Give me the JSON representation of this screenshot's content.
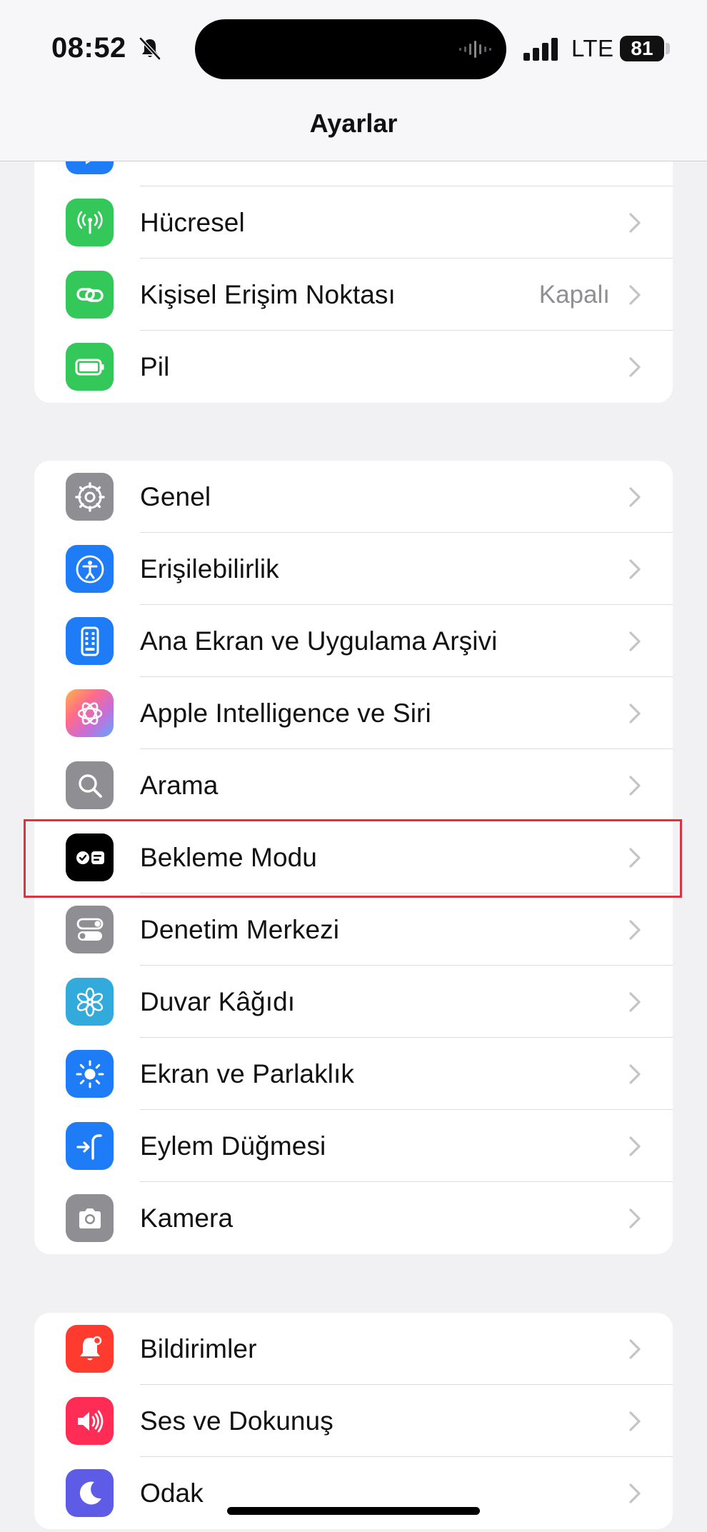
{
  "status_bar": {
    "time": "08:52",
    "network": "LTE",
    "battery": "81"
  },
  "header": {
    "title": "Ayarlar"
  },
  "groups": [
    {
      "items": [
        {
          "label": "",
          "icon": "partial-blue-icon",
          "color": "#1f7cf7"
        },
        {
          "label": "Hücresel",
          "icon": "antenna-icon",
          "color": "#34c759"
        },
        {
          "label": "Kişisel Erişim Noktası",
          "value": "Kapalı",
          "icon": "link-icon",
          "color": "#34c759"
        },
        {
          "label": "Pil",
          "icon": "battery-icon",
          "color": "#34c759"
        }
      ]
    },
    {
      "items": [
        {
          "label": "Genel",
          "icon": "gear-icon",
          "color": "#8e8e93"
        },
        {
          "label": "Erişilebilirlik",
          "icon": "accessibility-icon",
          "color": "#1f7cf7"
        },
        {
          "label": "Ana Ekran ve Uygulama Arşivi",
          "icon": "home-screen-icon",
          "color": "#1f7cf7"
        },
        {
          "label": "Apple Intelligence ve Siri",
          "icon": "apple-intelligence-icon",
          "color": "#c86dd7"
        },
        {
          "label": "Arama",
          "icon": "search-icon",
          "color": "#8e8e93"
        },
        {
          "label": "Bekleme Modu",
          "icon": "standby-icon",
          "color": "#000000"
        },
        {
          "label": "Denetim Merkezi",
          "icon": "toggles-icon",
          "color": "#8e8e93"
        },
        {
          "label": "Duvar Kâğıdı",
          "icon": "flower-icon",
          "color": "#33aadc"
        },
        {
          "label": "Ekran ve Parlaklık",
          "icon": "sun-icon",
          "color": "#1f7cf7"
        },
        {
          "label": "Eylem Düğmesi",
          "icon": "action-button-icon",
          "color": "#1f7cf7"
        },
        {
          "label": "Kamera",
          "icon": "camera-icon",
          "color": "#8e8e93"
        }
      ]
    },
    {
      "items": [
        {
          "label": "Bildirimler",
          "icon": "bell-icon",
          "color": "#ff3b30"
        },
        {
          "label": "Ses ve Dokunuş",
          "icon": "speaker-icon",
          "color": "#ff2d55"
        },
        {
          "label": "Odak",
          "icon": "moon-icon",
          "color": "#5e5ce6"
        }
      ]
    }
  ],
  "highlighted_item": "Bekleme Modu"
}
